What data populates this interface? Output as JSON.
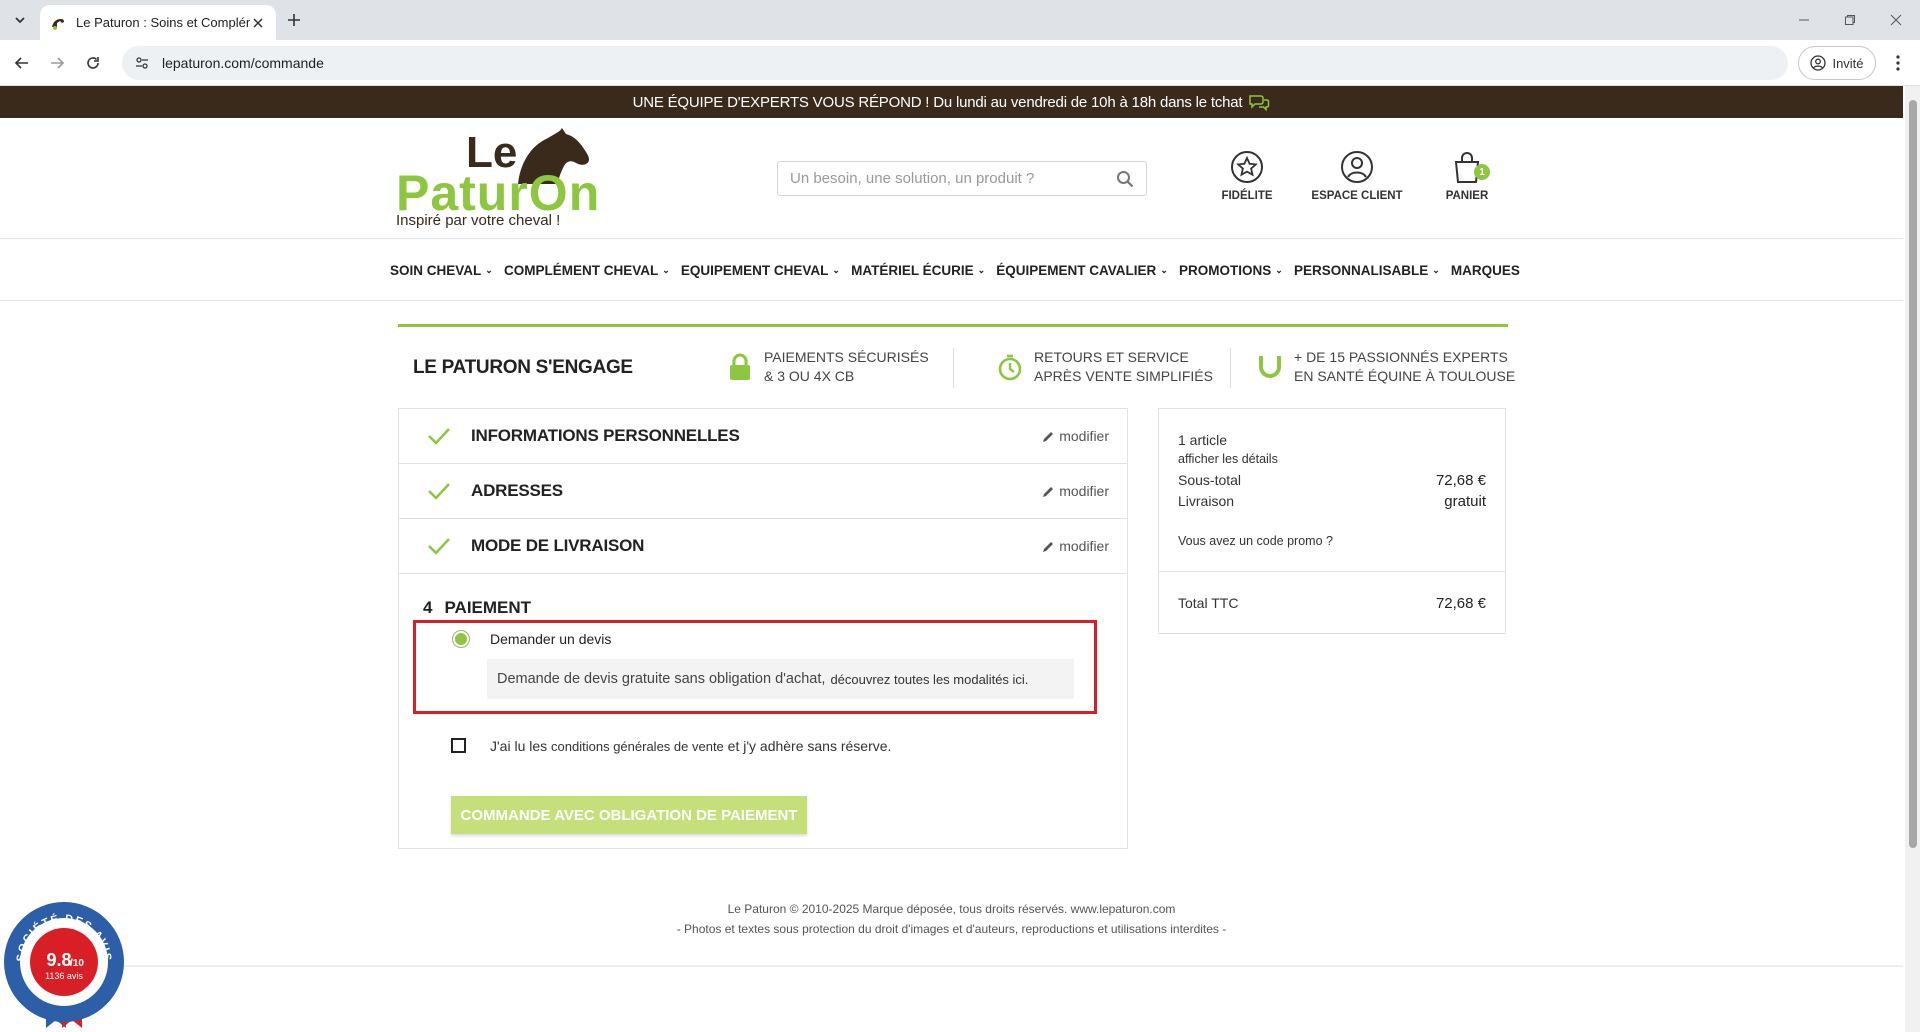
{
  "browser": {
    "tab_title": "Le Paturon : Soins et Complém",
    "url": "lepaturon.com/commande",
    "profile_label": "Invité"
  },
  "announcement": "UNE ÉQUIPE D'EXPERTS VOUS RÉPOND ! Du lundi au vendredi de 10h à 18h dans le tchat",
  "logo": {
    "line1": "Le",
    "line2": "PaturOn",
    "tagline": "Inspiré par votre cheval !"
  },
  "search": {
    "placeholder": "Un besoin, une solution, un produit ?"
  },
  "header_icons": {
    "fidelite": "FIDÉLITE",
    "espace_client": "ESPACE CLIENT",
    "panier": "PANIER",
    "cart_count": "1"
  },
  "menu": [
    {
      "label": "SOIN CHEVAL"
    },
    {
      "label": "COMPLÉMENT CHEVAL"
    },
    {
      "label": "EQUIPEMENT CHEVAL"
    },
    {
      "label": "MATÉRIEL ÉCURIE"
    },
    {
      "label": "ÉQUIPEMENT CAVALIER"
    },
    {
      "label": "PROMOTIONS"
    },
    {
      "label": "PERSONNALISABLE"
    },
    {
      "label": "MARQUES"
    }
  ],
  "engagement": {
    "title": "LE PATURON S'ENGAGE",
    "items": [
      {
        "line1": "PAIEMENTS SÉCURISÉS",
        "line2": "& 3 OU 4X CB"
      },
      {
        "line1": "RETOURS ET SERVICE",
        "line2": "APRÈS VENTE SIMPLIFIÉS"
      },
      {
        "line1": "+ DE 15 PASSIONNÉS EXPERTS",
        "line2": "EN SANTÉ ÉQUINE À TOULOUSE"
      }
    ]
  },
  "steps": [
    {
      "label": "INFORMATIONS PERSONNELLES",
      "action": "modifier"
    },
    {
      "label": "ADRESSES",
      "action": "modifier"
    },
    {
      "label": "MODE DE LIVRAISON",
      "action": "modifier"
    }
  ],
  "payment": {
    "number": "4",
    "title": "PAIEMENT",
    "option_label": "Demander un devis",
    "option_desc": "Demande de devis gratuite sans obligation d'achat,",
    "option_link": "découvrez toutes les modalités ici.",
    "cgv_prefix": "J'ai lu les",
    "cgv_link": "conditions générales de vente",
    "cgv_suffix": "et j'y adhère sans réserve.",
    "order_button": "COMMANDE AVEC OBLIGATION DE PAIEMENT"
  },
  "summary": {
    "article_count": "1 article",
    "details_link": "afficher les détails",
    "subtotal_label": "Sous-total",
    "subtotal_value": "72,68 €",
    "shipping_label": "Livraison",
    "shipping_value": "gratuit",
    "promo_link": "Vous avez un code promo ?",
    "total_label": "Total TTC",
    "total_value": "72,68 €"
  },
  "footer": {
    "line1": "Le Paturon © 2010-2025 Marque déposée, tous droits réservés. www.lepaturon.com",
    "line2": "- Photos et textes sous protection du droit d'images et d'auteurs, reproductions et utilisations interdites -"
  },
  "reviews_badge": {
    "score": "9.8",
    "scale": "/10",
    "count": "1136 avis",
    "ring_text": "SOCIÉTÉ DES AVIS GARANTIS"
  },
  "colors": {
    "brand_green": "#8dc63f",
    "brand_brown": "#3a2a1c",
    "highlight_red": "#d81f26",
    "button_green": "#c5e07b"
  }
}
